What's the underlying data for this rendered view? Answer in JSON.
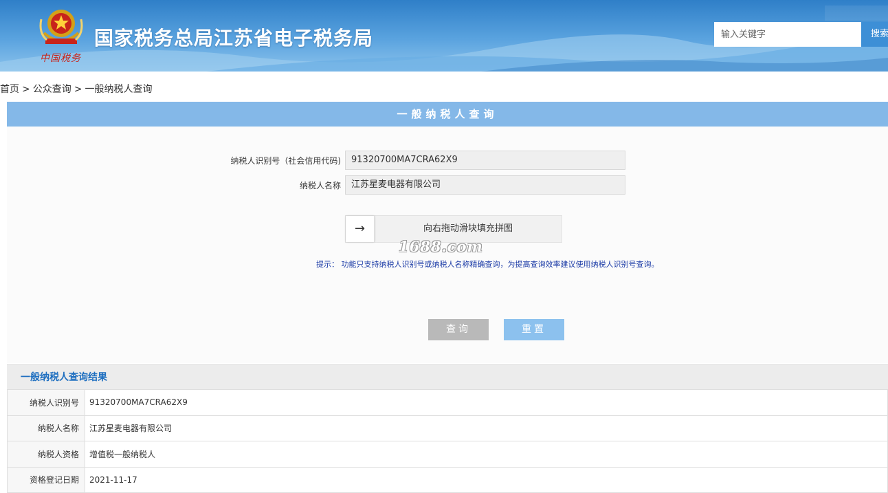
{
  "header": {
    "brand_subtitle": "中国税务",
    "site_title": "国家税务总局江苏省电子税务局",
    "search_placeholder": "输入关键字",
    "search_button": "搜索"
  },
  "breadcrumb": [
    "首页",
    "公众查询",
    "一般纳税人查询"
  ],
  "breadcrumb_separator": ">",
  "query_panel": {
    "title": "一般纳税人查询",
    "taxpayer_id_label": "纳税人识别号（社会信用代码)",
    "taxpayer_id_value": "91320700MA7CRA62X9",
    "taxpayer_name_label": "纳税人名称",
    "taxpayer_name_value": "江苏星麦电器有限公司",
    "slider_handle_icon": "arrow-right-icon",
    "slider_text": "向右拖动滑块填充拼图",
    "watermark": "1688.com",
    "hint": "提示： 功能只支持纳税人识别号或纳税人名称精确查询，为提高查询效率建议使用纳税人识别号查询。",
    "query_button": "查询",
    "reset_button": "重置"
  },
  "result": {
    "title": "一般纳税人查询结果",
    "rows": [
      {
        "label": "纳税人识别号",
        "value": "91320700MA7CRA62X9"
      },
      {
        "label": "纳税人名称",
        "value": "江苏星麦电器有限公司"
      },
      {
        "label": "纳税人资格",
        "value": "增值税一般纳税人"
      },
      {
        "label": "资格登记日期",
        "value": "2021-11-17"
      }
    ]
  },
  "colors": {
    "banner": "#4a95d8",
    "panel_header": "#84b8e8",
    "query_button": "#b9b9b9",
    "reset_button": "#8cc1ee",
    "hint_text": "#1a3aa6",
    "result_title": "#1f6fc0"
  }
}
